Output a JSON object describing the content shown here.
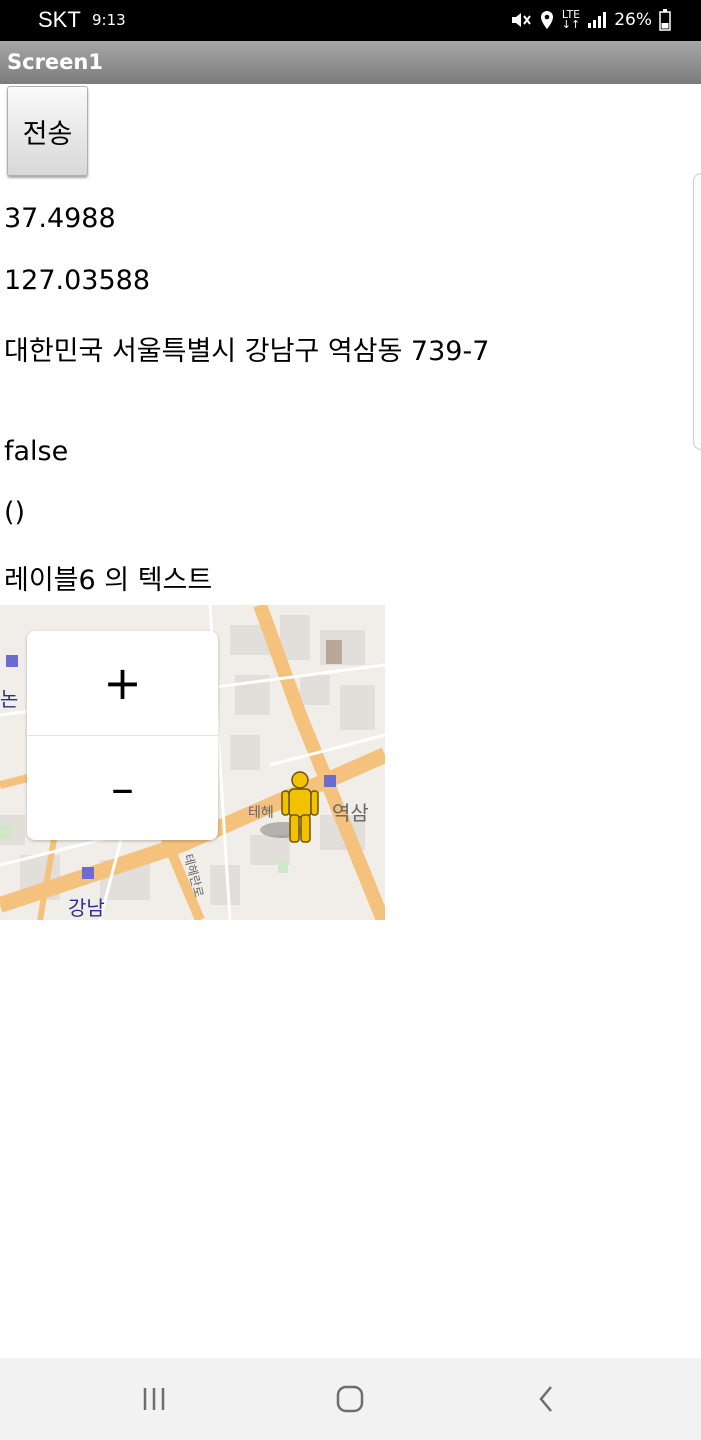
{
  "status_bar": {
    "carrier": "SKT",
    "time": "9:13",
    "network": "LTE",
    "battery": "26%",
    "icons": [
      "mute-icon",
      "location-icon",
      "lte-icon",
      "signal-icon",
      "battery-icon"
    ]
  },
  "titlebar": {
    "title": "Screen1"
  },
  "content": {
    "send_label": "전송",
    "latitude": "37.4988",
    "longitude": "127.03588",
    "address": "대한민국 서울특별시 강남구 역삼동 739-7",
    "bool_text": "false",
    "paren_text": "()",
    "label6": "레이블6 의 텍스트"
  },
  "map": {
    "zoom_in": "+",
    "zoom_out": "–",
    "labels": {
      "nonhyeon": "논",
      "yeoksam": "역삼",
      "gangnam": "강남",
      "teheran": "테헤",
      "road": "테헤란로"
    }
  },
  "navbar": {
    "icons": [
      "recent-apps-icon",
      "home-icon",
      "back-icon"
    ]
  },
  "colors": {
    "titlebar": "#8f8f8f",
    "road": "#f4c27c",
    "map_bg": "#f1eee9",
    "pegman": "#f2c200"
  }
}
